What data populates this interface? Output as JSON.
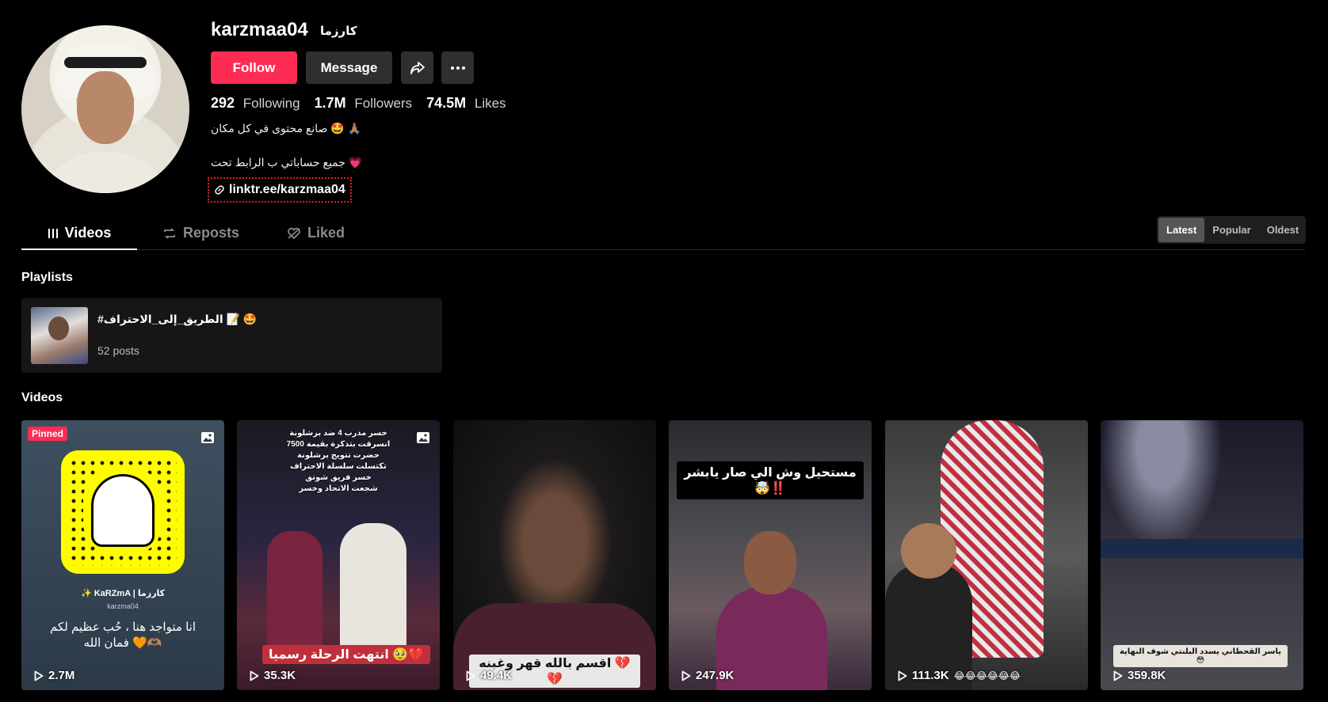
{
  "profile": {
    "username": "karzmaa04",
    "nickname": "كارزما",
    "follow_label": "Follow",
    "message_label": "Message",
    "stats": [
      {
        "value": "292",
        "label": "Following"
      },
      {
        "value": "1.7M",
        "label": "Followers"
      },
      {
        "value": "74.5M",
        "label": "Likes"
      }
    ],
    "bio_line1": "صانع محتوى في كل مكان 🤩 🙏🏽",
    "bio_line2": "جميع حساباتي ب الرابط تحت 💗",
    "link": "linktr.ee/karzmaa04"
  },
  "tabs": {
    "videos": "Videos",
    "reposts": "Reposts",
    "liked": "Liked"
  },
  "sort": {
    "latest": "Latest",
    "popular": "Popular",
    "oldest": "Oldest"
  },
  "playlists": {
    "title": "Playlists",
    "item": {
      "name": "#الطريق_إلى_الاحتراف 📝 🤩",
      "count": "52 posts"
    }
  },
  "videos": {
    "title": "Videos",
    "pinned_label": "Pinned",
    "items": [
      {
        "views": "2.7M",
        "caption": "انا متواجد هنا ، حُب عظيم لكم فمان الله 🧡🫶🏽",
        "handle": "✨ KaRZmA | كارزما",
        "sub": "karzma04"
      },
      {
        "views": "35.3K",
        "caption": "انتهت الرحلة رسميا 🥹💔",
        "top_text": "خسر مدرب 4 ضد برشلونة\nانسرقت بتذكرة بقيمة 7500\nحضرت تتويج برشلونة\nتكتسلت سلسلة الاحتراف\nخسر فريق شوتق\nشجعت الاتحاد وخسر"
      },
      {
        "views": "49.4K",
        "caption": "اقسم بالله قهر وغبنه 💔💔"
      },
      {
        "views": "247.9K",
        "caption": "مستحيل وش الي صار يابشر 🤯‼️"
      },
      {
        "views": "111.3K",
        "caption": "😂😂😂😂😂😂"
      },
      {
        "views": "359.8K",
        "caption": "ياسر القحطاني يسدد البلنتي شوف النهاية 😳"
      }
    ]
  },
  "colors": {
    "accent": "#fe2c55",
    "button_bg": "#2f2f2f"
  }
}
